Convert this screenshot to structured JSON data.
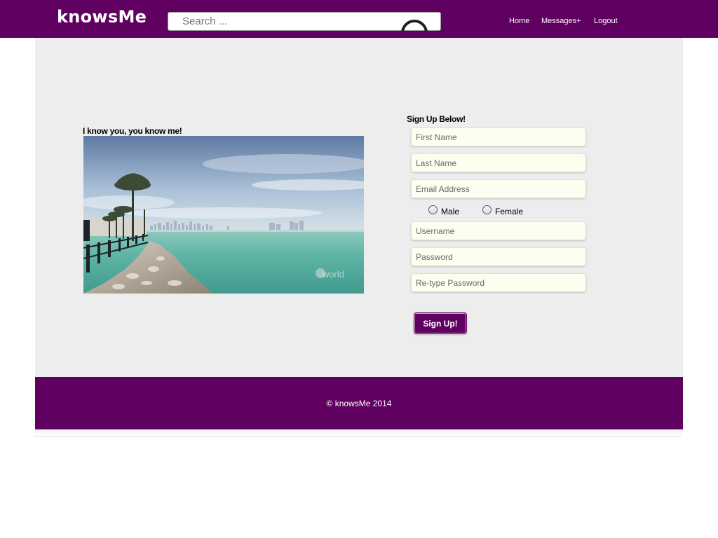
{
  "header": {
    "logo": "knowsMe",
    "search_placeholder": "Search ...",
    "nav": [
      "Home",
      "Messages+",
      "Logout"
    ]
  },
  "hero": {
    "tagline": "I know you, you know me!",
    "image_watermark": "world"
  },
  "signup": {
    "title": "Sign Up Below!",
    "fields": {
      "first_name": "First Name",
      "last_name": "Last Name",
      "email": "Email Address",
      "username": "Username",
      "password": "Password",
      "retype_password": "Re-type Password"
    },
    "gender_options": [
      "Male",
      "Female"
    ],
    "submit_label": "Sign Up!"
  },
  "footer": {
    "copyright": "© knowsMe 2014"
  },
  "colors": {
    "brand": "#600060",
    "panel": "#ededed",
    "field_bg": "#fefef0"
  }
}
